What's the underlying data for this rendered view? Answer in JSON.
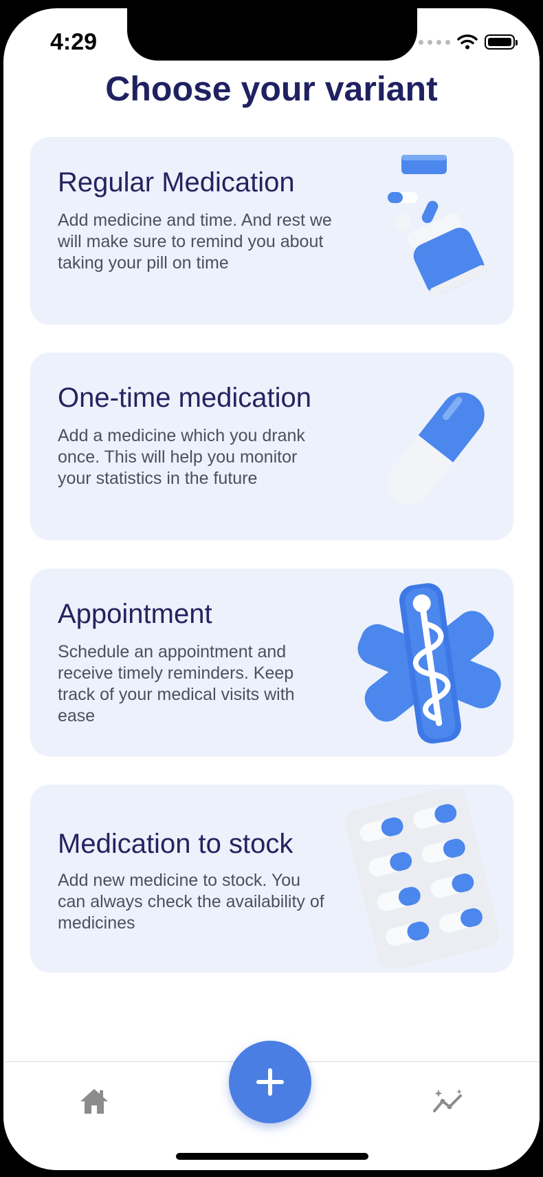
{
  "status_bar": {
    "time": "4:29"
  },
  "page": {
    "title": "Choose your variant"
  },
  "cards": [
    {
      "title": "Regular Medication",
      "description": "Add medicine and time. And rest we will make sure to remind you about taking your pill on time",
      "icon": "pill-bottle-icon"
    },
    {
      "title": "One-time medication",
      "description": "Add a medicine which you drank once. This will help you monitor your statistics in the future",
      "icon": "capsule-icon"
    },
    {
      "title": "Appointment",
      "description": "Schedule an appointment and receive timely reminders. Keep track of your medical visits with ease",
      "icon": "medical-star-icon"
    },
    {
      "title": "Medication to stock",
      "description": "Add new medicine to stock. You can always check the availability of medicines",
      "icon": "blister-pack-icon"
    }
  ],
  "tab_bar": {
    "items": [
      {
        "icon": "home-icon"
      },
      {
        "icon": "plus-icon"
      },
      {
        "icon": "statistics-icon"
      }
    ]
  },
  "colors": {
    "accent": "#4b7ee3",
    "title": "#1f2161",
    "card_bg": "#ecf1fb"
  }
}
